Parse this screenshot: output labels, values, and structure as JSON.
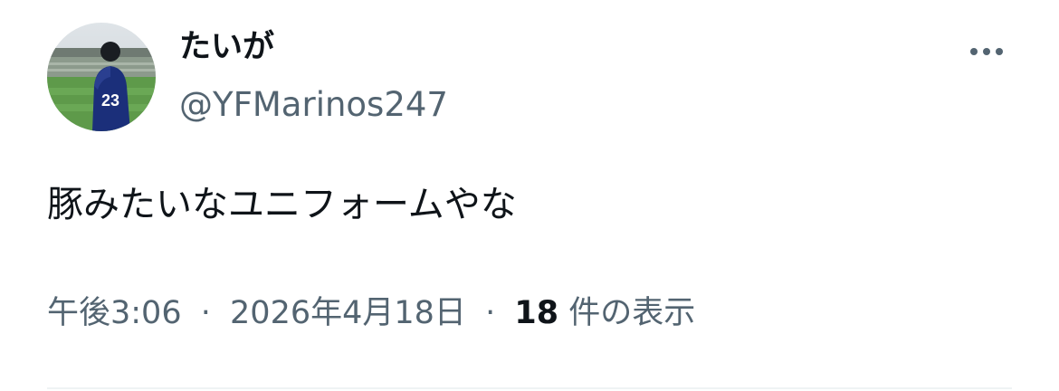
{
  "tweet": {
    "author": {
      "display_name": "たいが",
      "handle": "@YFMarinos247",
      "avatar_icon": "profile-photo-stadium",
      "jersey_number": "23"
    },
    "more_icon": "ellipsis-icon",
    "text": "豚みたいなユニフォームやな",
    "timestamp": {
      "time": "午後3:06",
      "date": "2026年4月18日",
      "separator": "·"
    },
    "views": {
      "count": "18",
      "label": "件の表示"
    }
  },
  "colors": {
    "text_primary": "#0f1419",
    "text_secondary": "#536471",
    "divider": "#eff3f4"
  }
}
